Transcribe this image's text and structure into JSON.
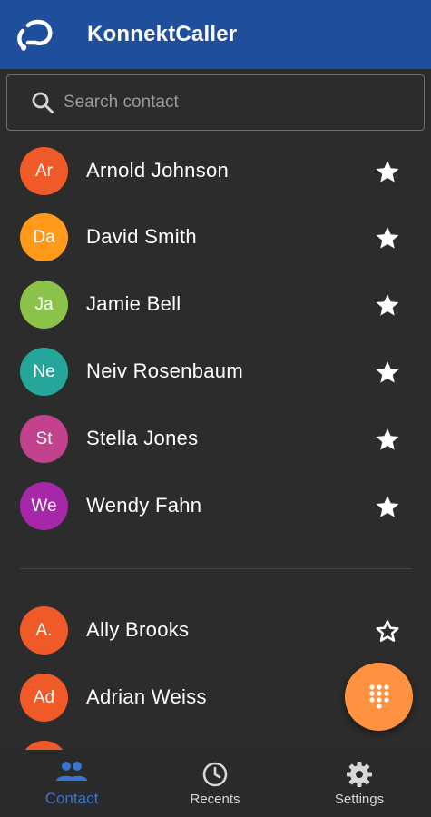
{
  "app": {
    "title": "KonnektCaller",
    "logo_icon": "konnekt-logo-icon"
  },
  "search": {
    "placeholder": "Search contact",
    "value": "",
    "icon": "search-icon"
  },
  "favorites": [
    {
      "initials": "Ar",
      "name": "Arnold Johnson",
      "color": "#f05a28",
      "starred": true
    },
    {
      "initials": "Da",
      "name": "David Smith",
      "color": "#ff9a1a",
      "starred": true
    },
    {
      "initials": "Ja",
      "name": "Jamie Bell",
      "color": "#8bc34a",
      "starred": true
    },
    {
      "initials": "Ne",
      "name": "Neiv Rosenbaum",
      "color": "#26a69a",
      "starred": true
    },
    {
      "initials": "St",
      "name": "Stella Jones",
      "color": "#c2428d",
      "starred": true
    },
    {
      "initials": "We",
      "name": "Wendy Fahn",
      "color": "#a628a8",
      "starred": true
    }
  ],
  "contacts": [
    {
      "initials": "A.",
      "name": "Ally Brooks",
      "color": "#f05a28",
      "starred": false
    },
    {
      "initials": "Ad",
      "name": "Adrian Weiss",
      "color": "#f05a28",
      "starred": false
    }
  ],
  "fab": {
    "icon": "dialpad-icon",
    "color": "#ff9240"
  },
  "nav": {
    "contact": {
      "label": "Contact",
      "icon": "people-icon",
      "active": true
    },
    "recents": {
      "label": "Recents",
      "icon": "clock-icon",
      "active": false
    },
    "settings": {
      "label": "Settings",
      "icon": "gear-icon",
      "active": false
    }
  },
  "colors": {
    "topbar": "#1f4e9c",
    "background": "#2c2c2c",
    "active_nav": "#3a73d0"
  }
}
